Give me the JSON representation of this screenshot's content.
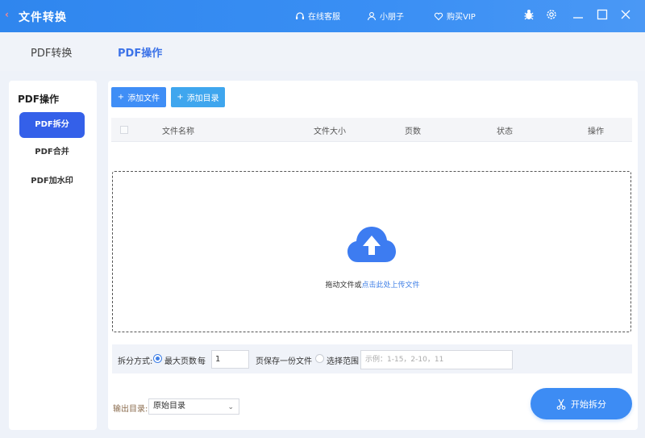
{
  "app": {
    "back_glyph": "‹",
    "title": "文件转换"
  },
  "titlebar": {
    "support_label": "在线客服",
    "user_label": "小朋子",
    "vip_label": "购买VIP",
    "icons": [
      "headset-icon",
      "user-icon",
      "heart-icon",
      "bug-icon",
      "gear-icon",
      "minimize-icon",
      "maximize-icon",
      "close-icon"
    ]
  },
  "tabs": [
    {
      "label": "PDF转换",
      "active": false
    },
    {
      "label": "PDF操作",
      "active": true
    }
  ],
  "sidebar": {
    "title": "PDF操作",
    "items": [
      {
        "label": "PDF拆分",
        "active": true
      },
      {
        "label": "PDF合并",
        "active": false
      },
      {
        "label": "PDF加水印",
        "active": false
      }
    ]
  },
  "toolbar": {
    "add_file": "添加文件",
    "add_dir": "添加目录"
  },
  "table": {
    "columns": [
      "文件名称",
      "文件大小",
      "页数",
      "状态",
      "操作"
    ]
  },
  "dropzone": {
    "text_prefix": "拖动文件或",
    "link_text": "点击此处上传文件"
  },
  "split": {
    "method_label": "拆分方式:",
    "option_max_pages": "最大页数",
    "per_label": "每",
    "per_value": "1",
    "save_label": "页保存一份文件",
    "option_range": "选择范围",
    "range_placeholder": "示例：1-15，2-10，11"
  },
  "output": {
    "label": "输出目录:",
    "selected": "原始目录"
  },
  "start_button": "开始拆分",
  "colors": {
    "titlebar": "#3a8ff4",
    "accent": "#3460e9",
    "link": "#3f7fe6",
    "start_button": "#3d8cf4"
  }
}
